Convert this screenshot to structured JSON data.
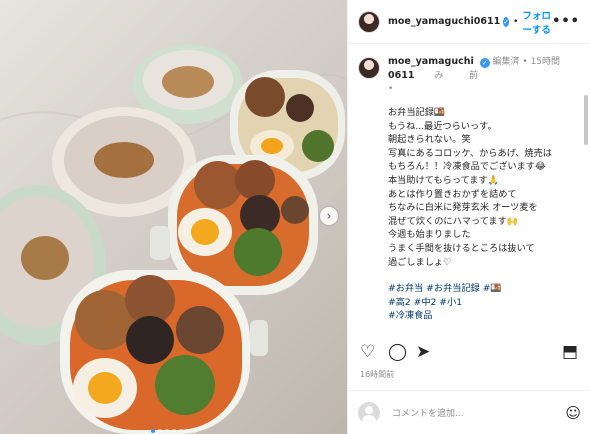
{
  "post": {
    "image_alt": "お弁当の写真",
    "carousel_dots": 7,
    "carousel_active": 0,
    "next_arrow": "›"
  },
  "header": {
    "username": "moe_yamaguchi0611",
    "follow_label": "フォローする",
    "sep": "•",
    "more": "•••"
  },
  "caption": {
    "username_line1": "moe_yamaguchi",
    "username_line2": "0611",
    "edited_line1": "編集済",
    "edited_line2": "み",
    "dot1": "•",
    "dot2": "•",
    "time_line1": "15時間",
    "time_line2": "前",
    "lines": [
      "お弁当記録🍱",
      "もうね...最近つらいっす。",
      "朝起きられない。笑",
      "写真にあるコロッケ、からあげ、焼売は",
      "もちろん！！冷凍食品でございます😂",
      "本当助けてもらってます🙏",
      "あとは作り置きおかずを詰めて",
      "ちなみに白米に発芽玄米 オーツ麦を",
      "混ぜて炊くのにハマってます🙌",
      "今週も始まりました",
      "うまく手間を抜けるところは抜いて",
      "過ごしましょ♡"
    ],
    "hashtags_1": "#お弁当 #お弁当記録 #🍱",
    "hashtags_2": "#高2 #中2 #小1",
    "hashtags_3": "#冷凍食品"
  },
  "actions": {
    "like_icon": "heart-icon",
    "comment_icon": "comment-icon",
    "share_icon": "share-icon",
    "save_icon": "bookmark-icon",
    "timestamp": "16時間前"
  },
  "comment_box": {
    "placeholder": "コメントを追加...",
    "emoji_icon": "emoji-icon"
  },
  "colors": {
    "accent": "#0095f6",
    "hashtag": "#00376b",
    "muted": "#8e8e8e"
  }
}
